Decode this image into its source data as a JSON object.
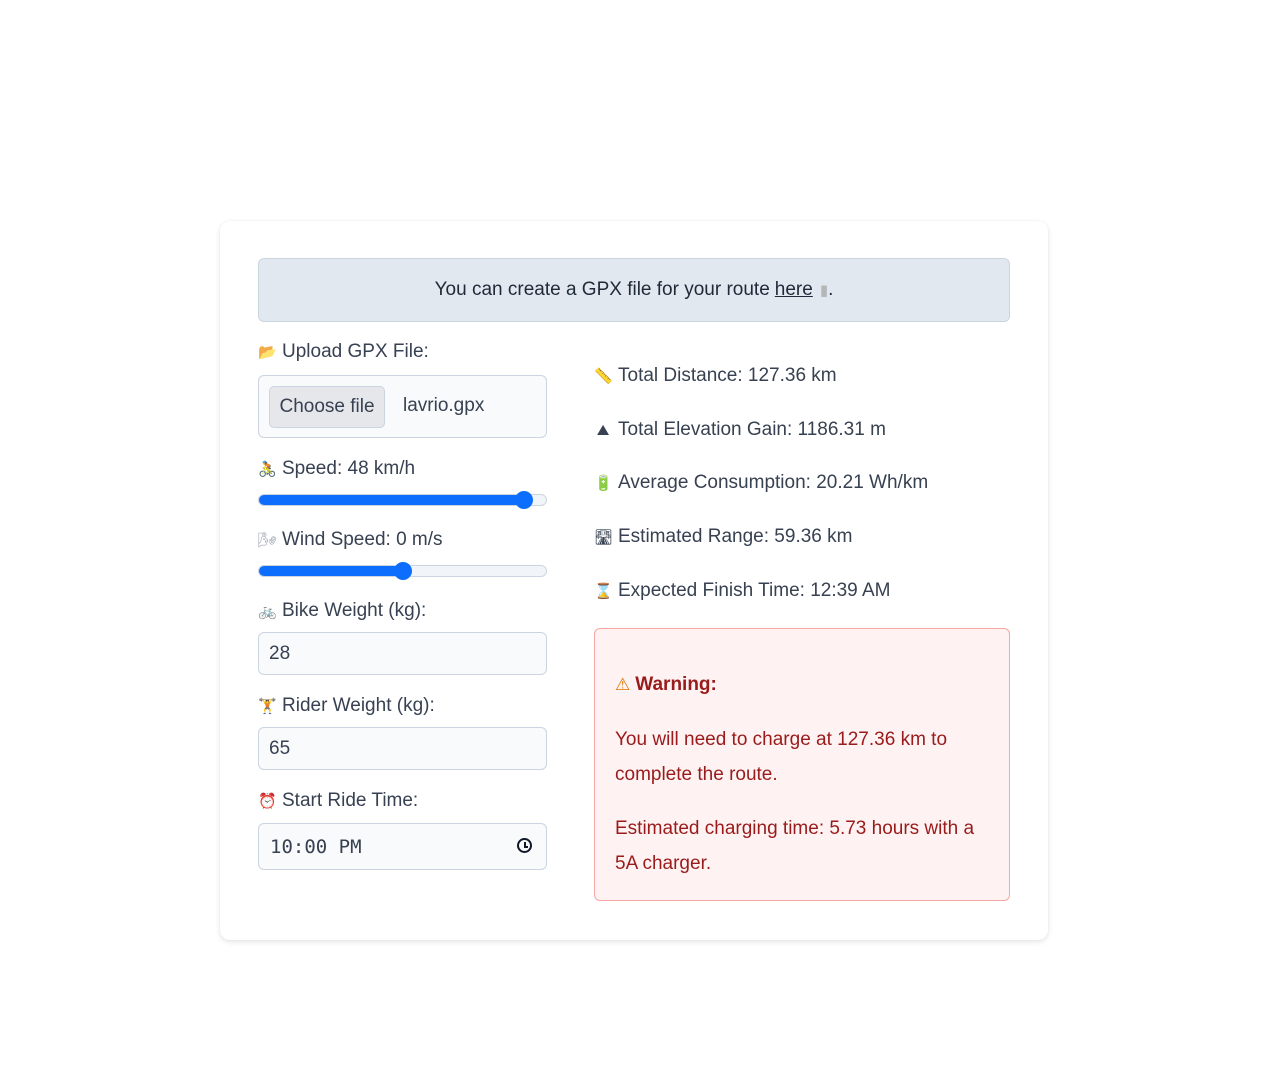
{
  "banner": {
    "text": "You can create a GPX file for your route",
    "link_text": "here",
    "link_icon": "page-icon",
    "trailing": "."
  },
  "upload": {
    "label": "Upload GPX File:",
    "icon": "folder-icon",
    "button_label": "Choose file",
    "file_name": "lavrio.gpx"
  },
  "speed": {
    "label": "Speed: 48 km/h",
    "icon": "cyclist-icon",
    "value": 48,
    "fraction": 0.92
  },
  "wind": {
    "label": "Wind Speed: 0 m/s",
    "icon": "wind-icon",
    "value": 0,
    "fraction": 0.5
  },
  "bike_weight": {
    "label": "Bike Weight (kg):",
    "icon": "bicycle-icon",
    "value": "28"
  },
  "rider_weight": {
    "label": "Rider Weight (kg):",
    "icon": "weightlifter-icon",
    "value": "65"
  },
  "start_time": {
    "label": "Start Ride Time:",
    "icon": "alarm-clock-icon",
    "value": "10:00 PM"
  },
  "stats": {
    "distance": {
      "icon": "ruler-icon",
      "text": "Total Distance: 127.36 km"
    },
    "elevation": {
      "icon": "mountain-icon",
      "text": "Total Elevation Gain: 1186.31 m"
    },
    "consumption": {
      "icon": "battery-icon",
      "text": "Average Consumption: 20.21 Wh/km"
    },
    "range": {
      "icon": "road-icon",
      "text": "Estimated Range: 59.36 km"
    },
    "finish": {
      "icon": "hourglass-icon",
      "text": "Expected Finish Time: 12:39 AM"
    }
  },
  "warning": {
    "icon": "warning-icon",
    "title": "Warning:",
    "message1": "You will need to charge at 127.36 km to complete the route.",
    "message2": "Estimated charging time: 5.73 hours with a 5A charger."
  },
  "colors": {
    "accent": "#0d6efd",
    "warning_text": "#991b1b",
    "warning_bg": "#fef2f2",
    "banner_bg": "#e2e8f0"
  }
}
